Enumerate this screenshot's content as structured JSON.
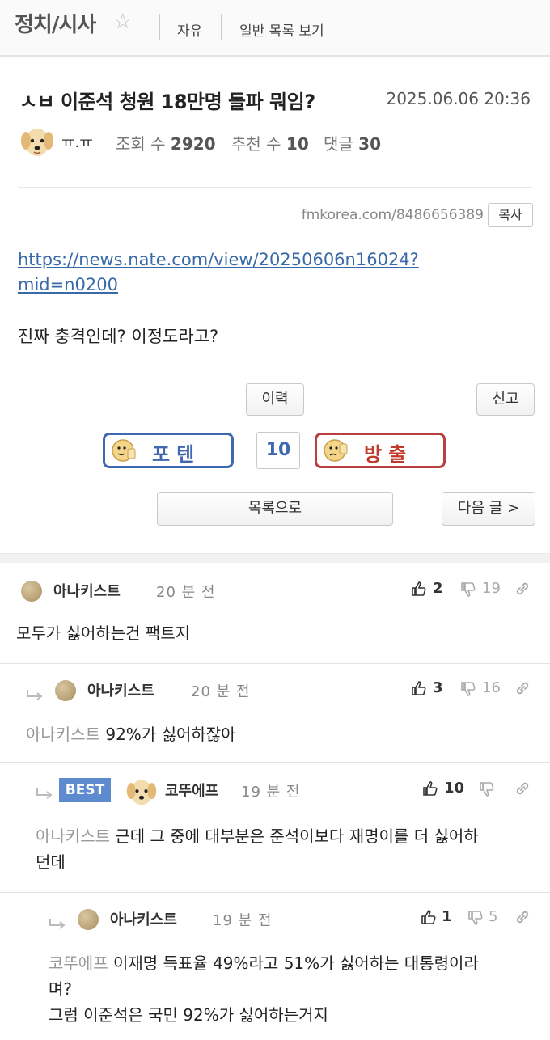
{
  "board": {
    "title": "정치/시사",
    "nav_free": "자유",
    "nav_list": "일반 목록 보기"
  },
  "post": {
    "title": "ㅅㅂ 이준석 청원 18만명 돌파 뭐임?",
    "date": "2025.06.06 20:36",
    "author": "ㅠ.ㅠ",
    "views_label": "조회 수",
    "views": "2920",
    "recs_label": "추천 수",
    "recs": "10",
    "comments_label": "댓글",
    "comments": "30",
    "short_url": "fmkorea.com/8486656389",
    "copy_label": "복사",
    "link_line1": "https://news.nate.com/view/20250606n16024?",
    "link_line2": "mid=n0200",
    "body": "진짜 충격인데? 이정도라고?"
  },
  "actions": {
    "history": "이력",
    "report": "신고",
    "upvote": "포텐",
    "vote_count": "10",
    "downvote": "방출",
    "to_list": "목록으로",
    "next": "다음 글 >"
  },
  "comments": [
    {
      "name": "아나키스트",
      "time": "20 분 전",
      "up": "2",
      "down": "19",
      "mention": "",
      "text": "모두가 싫어하는건 팩트지"
    },
    {
      "name": "아나키스트",
      "time": "20 분 전",
      "up": "3",
      "down": "16",
      "mention": "아나키스트",
      "text": " 92%가 싫어하잖아"
    },
    {
      "badge": "BEST",
      "name": "코뚜에프",
      "time": "19 분 전",
      "up": "10",
      "down": "",
      "mention": "아나키스트",
      "text": " 근데 그 중에 대부분은 준석이보다 재명이를 더 싫어하",
      "text2": "던데"
    },
    {
      "name": "아나키스트",
      "time": "19 분 전",
      "up": "1",
      "down": "5",
      "mention": "코뚜에프",
      "text": " 이재명 득표율 49%라고 51%가 싫어하는 대통령이라",
      "text2": "며?",
      "text3": "그럼 이준석은 국민 92%가 싫어하는거지"
    }
  ],
  "colors": {
    "link": "#3a6aa6",
    "upvote": "#3f68b0",
    "downvote": "#c0392b",
    "best": "#5e8ad0"
  },
  "icons": [
    "star-icon",
    "thumbs-up-icon",
    "thumbs-down-icon",
    "link-icon",
    "reply-arrow-icon",
    "dog-avatar-icon",
    "thumbs-up-face-icon",
    "thumbs-down-face-icon"
  ]
}
